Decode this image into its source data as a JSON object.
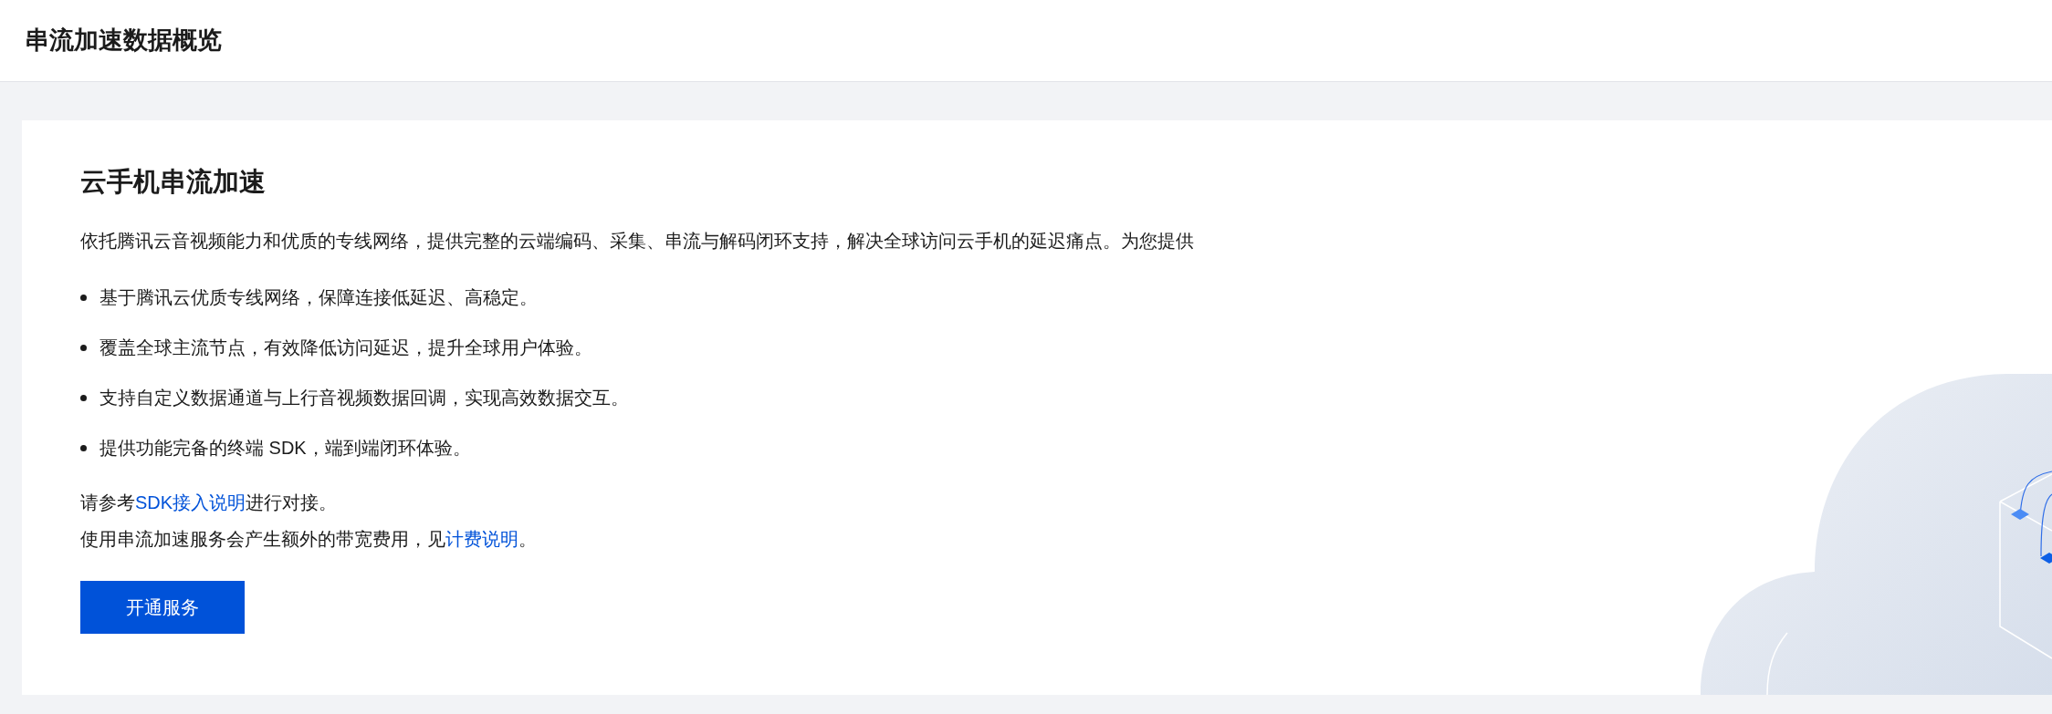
{
  "header": {
    "title": "串流加速数据概览"
  },
  "card": {
    "title": "云手机串流加速",
    "intro": "依托腾讯云音视频能力和优质的专线网络，提供完整的云端编码、采集、串流与解码闭环支持，解决全球访问云手机的延迟痛点。为您提供",
    "features": [
      "基于腾讯云优质专线网络，保障连接低延迟、高稳定。",
      "覆盖全球主流节点，有效降低访问延迟，提升全球用户体验。",
      "支持自定义数据通道与上行音视频数据回调，实现高效数据交互。",
      "提供功能完备的终端 SDK，端到端闭环体验。"
    ],
    "notes": [
      {
        "before": "请参考",
        "link": "SDK接入说明",
        "after": "进行对接。"
      },
      {
        "before": "使用串流加速服务会产生额外的带宽费用，见",
        "link": "计费说明",
        "after": "。"
      }
    ],
    "button": "开通服务"
  }
}
